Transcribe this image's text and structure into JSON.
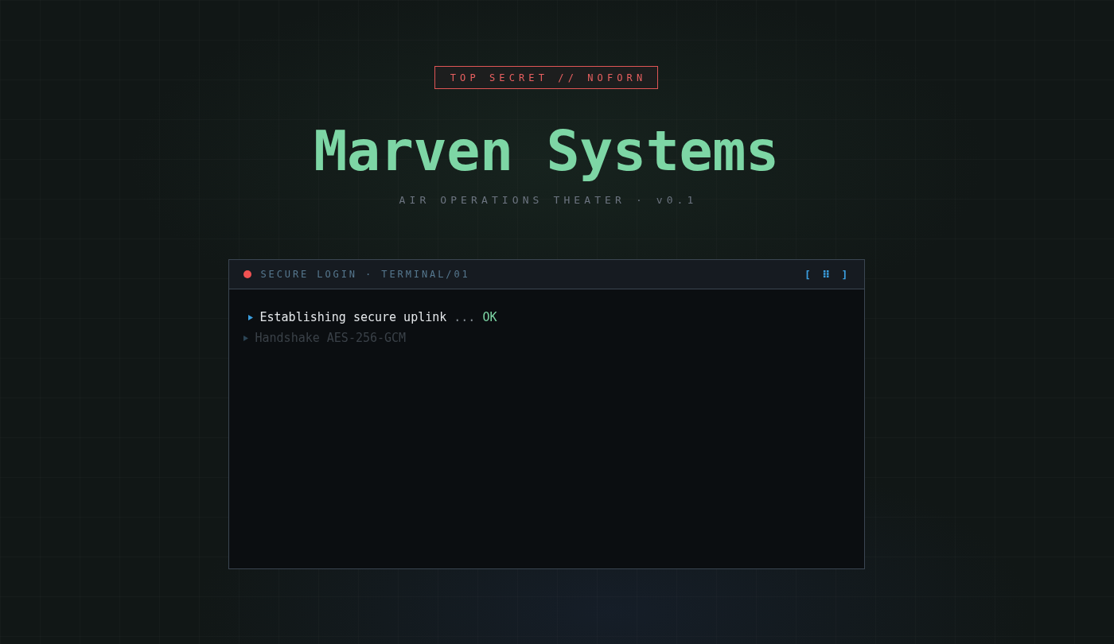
{
  "classification": "TOP SECRET // NOFORN",
  "title": "Marven Systems",
  "subtitle": "AIR OPERATIONS THEATER · v0.1",
  "terminal": {
    "header": {
      "label": "SECURE LOGIN · TERMINAL/01",
      "control": "[ ⠿ ]"
    },
    "lines": [
      {
        "text": "Establishing secure uplink",
        "ellipsis": "...",
        "result": "OK",
        "dimmed": false
      },
      {
        "text": "Handshake AES-256-GCM",
        "dimmed": true
      }
    ]
  }
}
